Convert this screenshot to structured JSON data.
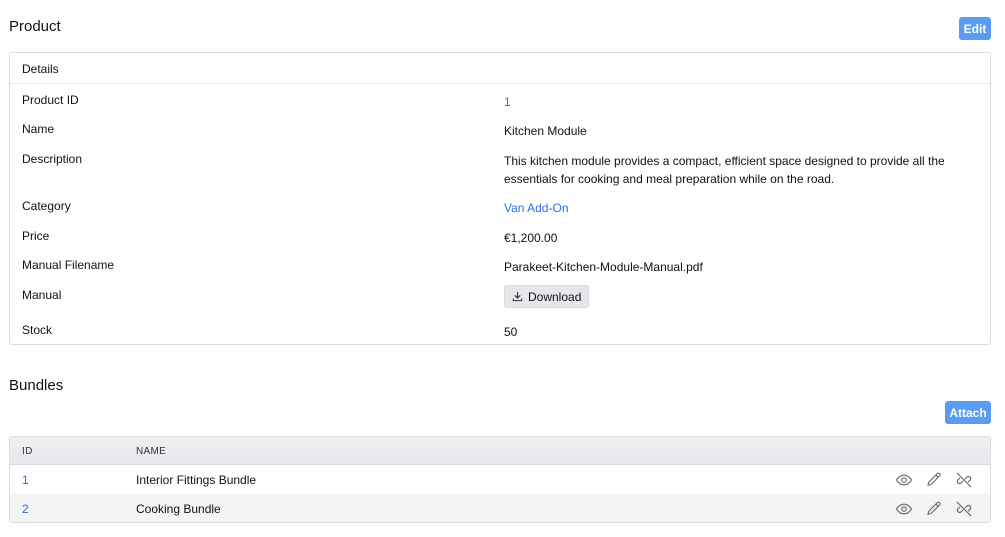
{
  "product": {
    "title": "Product",
    "edit_label": "Edit",
    "card_header": "Details",
    "fields": {
      "product_id": {
        "label": "Product ID",
        "value": "1"
      },
      "name": {
        "label": "Name",
        "value": "Kitchen Module"
      },
      "description": {
        "label": "Description",
        "value": "This kitchen module provides a compact, efficient space designed to provide all the essentials for cooking and meal preparation while on the road."
      },
      "category": {
        "label": "Category",
        "value": "Van Add-On"
      },
      "price": {
        "label": "Price",
        "value": "€1,200.00"
      },
      "manual_filename": {
        "label": "Manual Filename",
        "value": "Parakeet-Kitchen-Module-Manual.pdf"
      },
      "manual": {
        "label": "Manual",
        "download_label": "Download",
        "icon": "download-icon"
      },
      "stock": {
        "label": "Stock",
        "value": "50"
      }
    }
  },
  "bundles": {
    "title": "Bundles",
    "attach_label": "Attach",
    "columns": {
      "id": "ID",
      "name": "NAME"
    },
    "rows": [
      {
        "id": "1",
        "name": "Interior Fittings Bundle"
      },
      {
        "id": "2",
        "name": "Cooking Bundle"
      }
    ],
    "row_actions": [
      "eye-icon",
      "pencil-icon",
      "unlink-icon"
    ]
  },
  "colors": {
    "primary": "#5b9cf2",
    "link": "#2f6fe0",
    "border": "#dcdcdc"
  }
}
